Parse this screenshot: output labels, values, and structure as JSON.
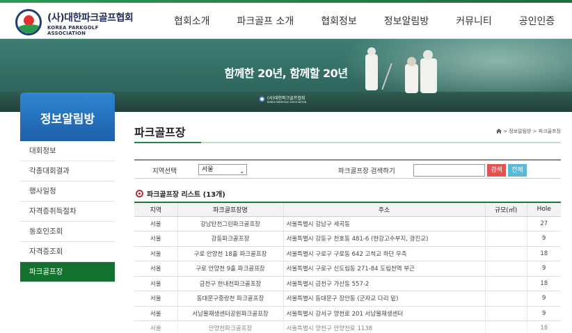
{
  "header": {
    "logo_ko": "(사)대한파크골프협회",
    "logo_en": "KOREA PARKGOLF ASSOCIATION",
    "nav": [
      "협회소개",
      "파크골프 소개",
      "협회정보",
      "정보알림방",
      "커뮤니티",
      "공인인증"
    ]
  },
  "banner": {
    "slogan": "함께한 20년, 함께할 20년",
    "logo_text": "(사)대한파크골프협회",
    "logo_sub": "KOREA PARKGOLF ASSOCIATION"
  },
  "sidebar": {
    "title": "정보알림방",
    "items": [
      "대회정보",
      "각종대회결과",
      "행사일정",
      "자격증취득절차",
      "동호인조회",
      "자격증조회",
      "파크골프장"
    ],
    "active_index": 6
  },
  "page": {
    "title": "파크골프장",
    "breadcrumb": "> 정보알림방 > 파크골프장"
  },
  "search": {
    "region_label": "지역선택",
    "region_value": "서울",
    "keyword_label": "파크골프장 검색하기",
    "keyword_value": "",
    "search_button": "검색",
    "all_button": "전체"
  },
  "list": {
    "title": "파크골프장 리스트 (13개)",
    "columns": [
      "지역",
      "파크골프장명",
      "주소",
      "규모(㎡)",
      "Hole"
    ],
    "rows": [
      [
        "서울",
        "강남탄천그린파크골프장",
        "서울특별시 강남구 세곡동",
        "",
        "27"
      ],
      [
        "서울",
        "강동파크골프장",
        "서울특별시 강동구 천호동 481-6 (한강고수부지, 광진교)",
        "",
        "9"
      ],
      [
        "서울",
        "구로 안양천 18홀 파크골프장",
        "서울특별시 구로구 구로동 642 고척교 하단 우측",
        "",
        "18"
      ],
      [
        "서울",
        "구로 안양천 9홀 파크골프장",
        "서울특별시 구로구 신도림동 271-84 도림천역 부근",
        "",
        "9"
      ],
      [
        "서울",
        "금천구 한내천파크골프장",
        "서울특별시 금천구 가산동 557-2",
        "",
        "18"
      ],
      [
        "서울",
        "동대문구중랑천 파크골프장",
        "서울특별시 동대문구 장안동 (군자교 다리 밑)",
        "",
        "9"
      ],
      [
        "서울",
        "서남물재생센터공원파크골프장",
        "서울특별시 강서구 양천로 201 서남물재생센터",
        "",
        "9"
      ],
      [
        "서울",
        "안양천파크골프장",
        "서울특별시 양천구 안양천로 1138",
        "",
        "18"
      ]
    ]
  },
  "colors": {
    "brand_green": "#13722e",
    "sidebar_blue": "#2f86d1",
    "search_red": "#e15454",
    "all_blue": "#5bb7d6"
  }
}
